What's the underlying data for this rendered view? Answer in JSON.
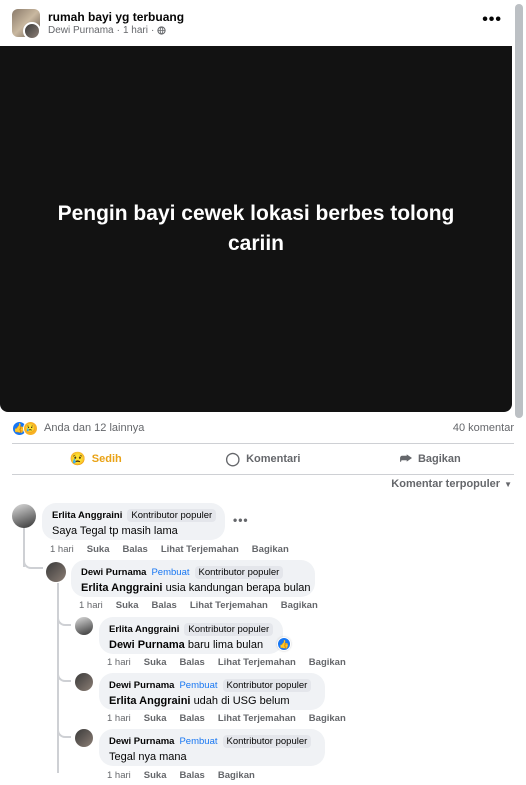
{
  "post": {
    "group_name": "rumah bayi yg terbuang",
    "author": "Dewi Purnama",
    "time": "1 hari",
    "separator": "·",
    "privacy_icon": "globe-icon",
    "more_icon": "•••",
    "image_text": "Pengin bayi cewek lokasi berbes tolong cariin"
  },
  "reactions": {
    "summary": "Anda dan 12 lainnya",
    "comment_count": "40 komentar",
    "like_glyph": "👍",
    "sad_glyph": "😢"
  },
  "actions": {
    "react_label": "Sedih",
    "react_glyph": "😢",
    "comment_label": "Komentari",
    "comment_glyph": "◯",
    "share_label": "Bagikan",
    "share_glyph": "⮫"
  },
  "sort": {
    "label": "Komentar terpopuler",
    "arrow": "▼"
  },
  "comments": [
    {
      "author": "Erlita Anggraini",
      "badges": [
        "Kontributor populer"
      ],
      "text": "Saya Tegal tp masih lama",
      "time": "1 hari",
      "like": "Suka",
      "reply": "Balas",
      "translate": "Lihat Terjemahan",
      "share": "Bagikan",
      "more": "•••"
    },
    {
      "author": "Dewi Purnama",
      "badges": [
        "Pembuat",
        "Kontributor populer"
      ],
      "mention": "Erlita Anggraini",
      "text": "usia kandungan berapa bulan",
      "time": "1 hari",
      "like": "Suka",
      "reply": "Balas",
      "translate": "Lihat Terjemahan",
      "share": "Bagikan"
    },
    {
      "author": "Erlita Anggraini",
      "badges": [
        "Kontributor populer"
      ],
      "mention": "Dewi Purnama",
      "text": "baru lima bulan",
      "time": "1 hari",
      "like": "Suka",
      "reply": "Balas",
      "translate": "Lihat Terjemahan",
      "share": "Bagikan",
      "like_glyph": "👍"
    },
    {
      "author": "Dewi Purnama",
      "badges": [
        "Pembuat",
        "Kontributor populer"
      ],
      "mention": "Erlita Anggraini",
      "text": "udah di USG belum",
      "time": "1 hari",
      "like": "Suka",
      "reply": "Balas",
      "translate": "Lihat Terjemahan",
      "share": "Bagikan"
    },
    {
      "author": "Dewi Purnama",
      "badges": [
        "Pembuat",
        "Kontributor populer"
      ],
      "text": "Tegal nya mana",
      "time": "1 hari",
      "like": "Suka",
      "reply": "Balas",
      "share": "Bagikan"
    }
  ],
  "colors": {
    "accent": "#1877f2",
    "sad": "#e9a215",
    "image_bg": "#121212"
  }
}
